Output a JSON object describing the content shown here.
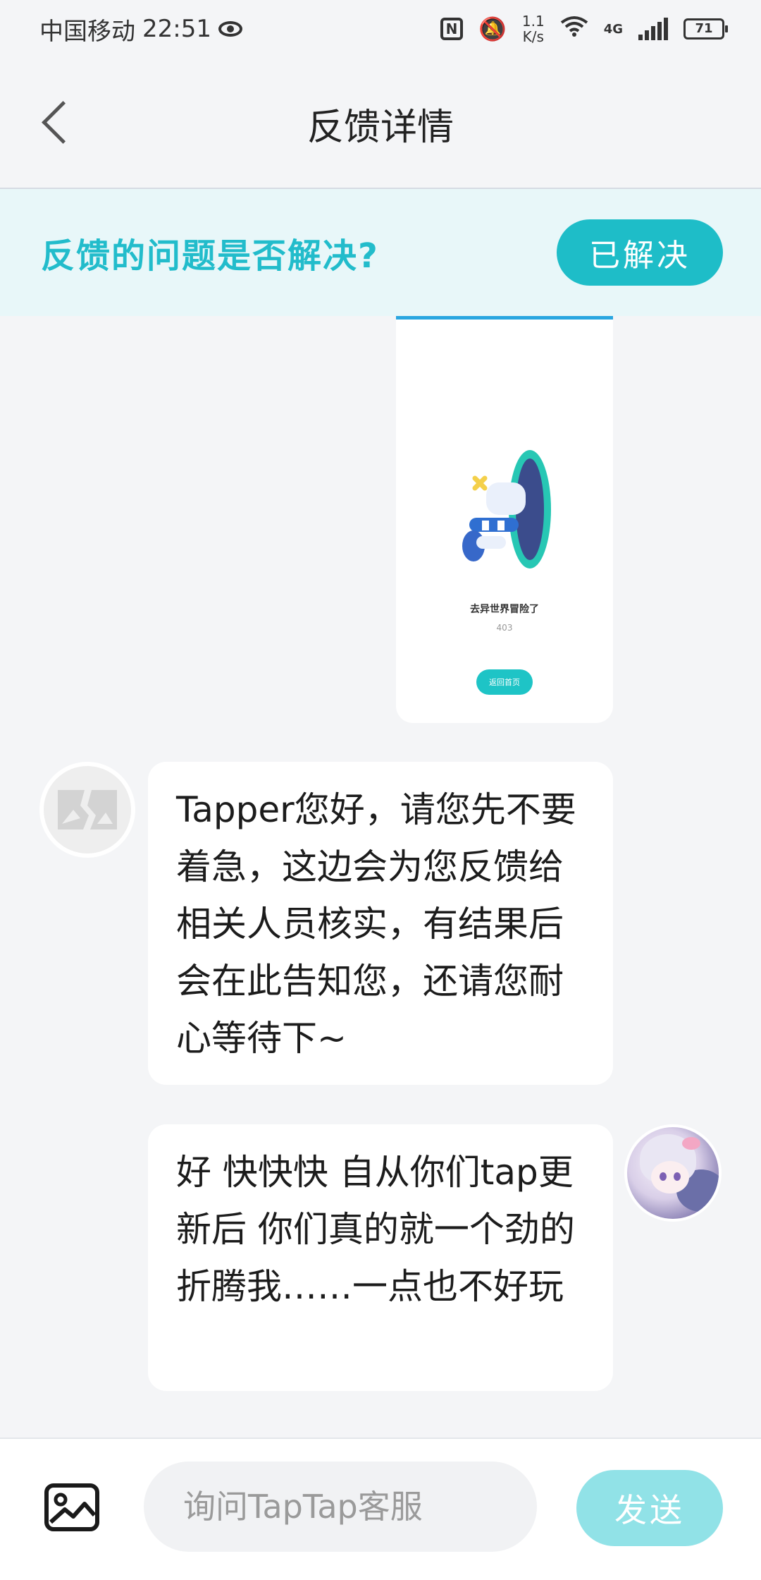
{
  "status_bar": {
    "carrier": "中国移动",
    "time": "22:51",
    "net_speed_value": "1.1",
    "net_speed_unit": "K/s",
    "network_type": "4G",
    "battery": "71",
    "icons": [
      "eye-icon",
      "nfc-icon",
      "mute-icon",
      "wifi-icon",
      "signal-icon",
      "battery-icon"
    ]
  },
  "header": {
    "title": "反馈详情"
  },
  "banner": {
    "question": "反馈的问题是否解决?",
    "resolved_label": "已解决"
  },
  "screenshot": {
    "caption": "去异世界冒险了",
    "code": "403",
    "button_label": "返回首页"
  },
  "messages": [
    {
      "sender": "support",
      "text": "Tapper您好，请您先不要着急，这边会为您反馈给相关人员核实，有结果后会在此告知您，还请您耐心等待下~"
    },
    {
      "sender": "user",
      "text": "好 快快快 自从你们tap更新后 你们真的就一个劲的折腾我……一点也不好玩"
    }
  ],
  "footer": {
    "input_placeholder": "询问TapTap客服",
    "send_label": "发送"
  },
  "colors": {
    "accent": "#1ebdc8",
    "banner_bg": "#e8f7f9",
    "send_disabled": "#91e2e7",
    "background": "#f4f5f7"
  }
}
